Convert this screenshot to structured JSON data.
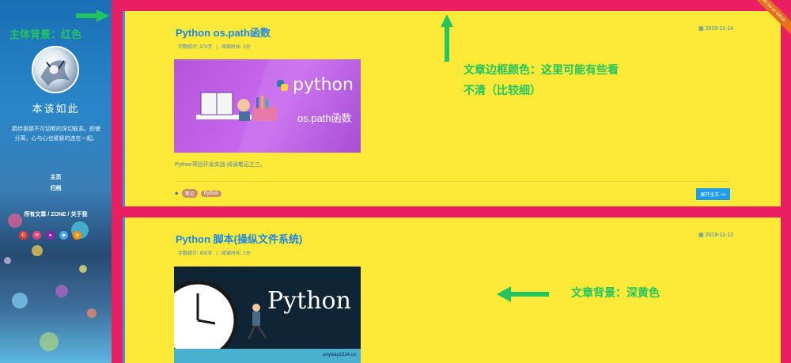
{
  "sidebar": {
    "site_name": "本该如此",
    "motto": "羁绊是那不可切断的深切联系。即使分离，心与心也紧紧的连在一起。",
    "nav": [
      "主页",
      "归档"
    ],
    "links_line": "所有文章 / ZONE / 关于我",
    "social_colors": [
      "#e53935",
      "#ec407a",
      "#8e24aa",
      "#42a5f5",
      "#fb8c00"
    ]
  },
  "annotations": {
    "body_bg": "主体背景：红色",
    "border_color_line1": "文章边框颜色：这里可能有些看",
    "border_color_line2": "不清（比较细）",
    "article_bg": "文章背景：深黄色"
  },
  "ribbon": "Fork me on GitHub",
  "posts": [
    {
      "title": "Python os.path函数",
      "date": "2019-11-14",
      "word_count": "字数统计: 374字",
      "read_time": "阅读时长: 1分",
      "thumb_text_main": "python",
      "thumb_text_sub": "os.path函数",
      "summary": "Python项目开发实战 阅读笔记之三。",
      "tags": [
        "笔记",
        "Python"
      ],
      "read_more": "展开全文 >>"
    },
    {
      "title": "Python 脚本(操纵文件系统)",
      "date": "2019-11-12",
      "word_count": "字数统计: 455字",
      "read_time": "阅读时长: 1分",
      "thumb_text_main": "Python",
      "thumb_footer": "anyway1314.cn"
    }
  ]
}
